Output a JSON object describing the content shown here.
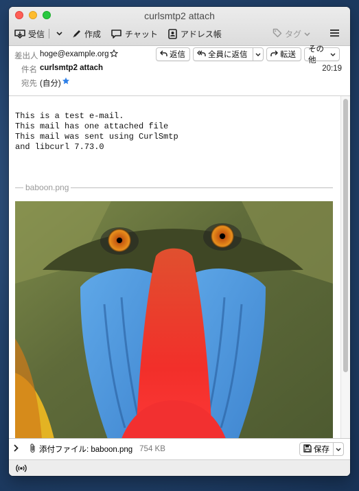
{
  "window": {
    "title": "curlsmtp2 attach"
  },
  "toolbar": {
    "get_mail": "受信",
    "write": "作成",
    "chat": "チャット",
    "address_book": "アドレス帳",
    "tag": "タグ"
  },
  "header": {
    "from_label": "差出人",
    "from_value": "hoge@example.org",
    "subject_label": "件名",
    "subject_value": "curlsmtp2 attach",
    "to_label": "宛先",
    "to_value": "(自分)",
    "time": "20:19",
    "reply": "返信",
    "reply_all": "全員に返信",
    "forward": "転送",
    "more": "その他"
  },
  "message": {
    "body": "This is a test e-mail.\nThis mail has one attached file\nThis mail was sent using CurlSmtp\nand libcurl 7.73.0",
    "attachment_separator": "baboon.png"
  },
  "attachment_bar": {
    "label": "添付ファイル: baboon.png",
    "size": "754 KB",
    "save": "保存"
  },
  "colors": {
    "star_blue": "#2e80e8",
    "close": "#fe5f57",
    "minimize": "#febc2e",
    "zoom": "#28c840"
  }
}
